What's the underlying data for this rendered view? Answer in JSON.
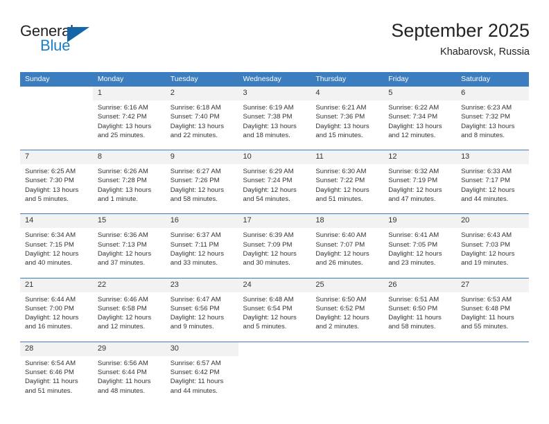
{
  "brand": {
    "word_general": "General",
    "word_blue": "Blue",
    "triangle_color": "#1466a8",
    "blue_color": "#1b7fc4"
  },
  "header": {
    "title": "September 2025",
    "subtitle": "Khabarovsk, Russia"
  },
  "theme": {
    "header_blue": "#3c7dc0",
    "daynum_bg": "#f2f2f2",
    "separator": "#3c7dc0",
    "text": "#333333"
  },
  "weekday_headers": [
    "Sunday",
    "Monday",
    "Tuesday",
    "Wednesday",
    "Thursday",
    "Friday",
    "Saturday"
  ],
  "weeks": [
    {
      "days": [
        {
          "num": "",
          "sunrise": "",
          "sunset": "",
          "daylight1": "",
          "daylight2": ""
        },
        {
          "num": "1",
          "sunrise": "Sunrise: 6:16 AM",
          "sunset": "Sunset: 7:42 PM",
          "daylight1": "Daylight: 13 hours",
          "daylight2": "and 25 minutes."
        },
        {
          "num": "2",
          "sunrise": "Sunrise: 6:18 AM",
          "sunset": "Sunset: 7:40 PM",
          "daylight1": "Daylight: 13 hours",
          "daylight2": "and 22 minutes."
        },
        {
          "num": "3",
          "sunrise": "Sunrise: 6:19 AM",
          "sunset": "Sunset: 7:38 PM",
          "daylight1": "Daylight: 13 hours",
          "daylight2": "and 18 minutes."
        },
        {
          "num": "4",
          "sunrise": "Sunrise: 6:21 AM",
          "sunset": "Sunset: 7:36 PM",
          "daylight1": "Daylight: 13 hours",
          "daylight2": "and 15 minutes."
        },
        {
          "num": "5",
          "sunrise": "Sunrise: 6:22 AM",
          "sunset": "Sunset: 7:34 PM",
          "daylight1": "Daylight: 13 hours",
          "daylight2": "and 12 minutes."
        },
        {
          "num": "6",
          "sunrise": "Sunrise: 6:23 AM",
          "sunset": "Sunset: 7:32 PM",
          "daylight1": "Daylight: 13 hours",
          "daylight2": "and 8 minutes."
        }
      ]
    },
    {
      "days": [
        {
          "num": "7",
          "sunrise": "Sunrise: 6:25 AM",
          "sunset": "Sunset: 7:30 PM",
          "daylight1": "Daylight: 13 hours",
          "daylight2": "and 5 minutes."
        },
        {
          "num": "8",
          "sunrise": "Sunrise: 6:26 AM",
          "sunset": "Sunset: 7:28 PM",
          "daylight1": "Daylight: 13 hours",
          "daylight2": "and 1 minute."
        },
        {
          "num": "9",
          "sunrise": "Sunrise: 6:27 AM",
          "sunset": "Sunset: 7:26 PM",
          "daylight1": "Daylight: 12 hours",
          "daylight2": "and 58 minutes."
        },
        {
          "num": "10",
          "sunrise": "Sunrise: 6:29 AM",
          "sunset": "Sunset: 7:24 PM",
          "daylight1": "Daylight: 12 hours",
          "daylight2": "and 54 minutes."
        },
        {
          "num": "11",
          "sunrise": "Sunrise: 6:30 AM",
          "sunset": "Sunset: 7:22 PM",
          "daylight1": "Daylight: 12 hours",
          "daylight2": "and 51 minutes."
        },
        {
          "num": "12",
          "sunrise": "Sunrise: 6:32 AM",
          "sunset": "Sunset: 7:19 PM",
          "daylight1": "Daylight: 12 hours",
          "daylight2": "and 47 minutes."
        },
        {
          "num": "13",
          "sunrise": "Sunrise: 6:33 AM",
          "sunset": "Sunset: 7:17 PM",
          "daylight1": "Daylight: 12 hours",
          "daylight2": "and 44 minutes."
        }
      ]
    },
    {
      "days": [
        {
          "num": "14",
          "sunrise": "Sunrise: 6:34 AM",
          "sunset": "Sunset: 7:15 PM",
          "daylight1": "Daylight: 12 hours",
          "daylight2": "and 40 minutes."
        },
        {
          "num": "15",
          "sunrise": "Sunrise: 6:36 AM",
          "sunset": "Sunset: 7:13 PM",
          "daylight1": "Daylight: 12 hours",
          "daylight2": "and 37 minutes."
        },
        {
          "num": "16",
          "sunrise": "Sunrise: 6:37 AM",
          "sunset": "Sunset: 7:11 PM",
          "daylight1": "Daylight: 12 hours",
          "daylight2": "and 33 minutes."
        },
        {
          "num": "17",
          "sunrise": "Sunrise: 6:39 AM",
          "sunset": "Sunset: 7:09 PM",
          "daylight1": "Daylight: 12 hours",
          "daylight2": "and 30 minutes."
        },
        {
          "num": "18",
          "sunrise": "Sunrise: 6:40 AM",
          "sunset": "Sunset: 7:07 PM",
          "daylight1": "Daylight: 12 hours",
          "daylight2": "and 26 minutes."
        },
        {
          "num": "19",
          "sunrise": "Sunrise: 6:41 AM",
          "sunset": "Sunset: 7:05 PM",
          "daylight1": "Daylight: 12 hours",
          "daylight2": "and 23 minutes."
        },
        {
          "num": "20",
          "sunrise": "Sunrise: 6:43 AM",
          "sunset": "Sunset: 7:03 PM",
          "daylight1": "Daylight: 12 hours",
          "daylight2": "and 19 minutes."
        }
      ]
    },
    {
      "days": [
        {
          "num": "21",
          "sunrise": "Sunrise: 6:44 AM",
          "sunset": "Sunset: 7:00 PM",
          "daylight1": "Daylight: 12 hours",
          "daylight2": "and 16 minutes."
        },
        {
          "num": "22",
          "sunrise": "Sunrise: 6:46 AM",
          "sunset": "Sunset: 6:58 PM",
          "daylight1": "Daylight: 12 hours",
          "daylight2": "and 12 minutes."
        },
        {
          "num": "23",
          "sunrise": "Sunrise: 6:47 AM",
          "sunset": "Sunset: 6:56 PM",
          "daylight1": "Daylight: 12 hours",
          "daylight2": "and 9 minutes."
        },
        {
          "num": "24",
          "sunrise": "Sunrise: 6:48 AM",
          "sunset": "Sunset: 6:54 PM",
          "daylight1": "Daylight: 12 hours",
          "daylight2": "and 5 minutes."
        },
        {
          "num": "25",
          "sunrise": "Sunrise: 6:50 AM",
          "sunset": "Sunset: 6:52 PM",
          "daylight1": "Daylight: 12 hours",
          "daylight2": "and 2 minutes."
        },
        {
          "num": "26",
          "sunrise": "Sunrise: 6:51 AM",
          "sunset": "Sunset: 6:50 PM",
          "daylight1": "Daylight: 11 hours",
          "daylight2": "and 58 minutes."
        },
        {
          "num": "27",
          "sunrise": "Sunrise: 6:53 AM",
          "sunset": "Sunset: 6:48 PM",
          "daylight1": "Daylight: 11 hours",
          "daylight2": "and 55 minutes."
        }
      ]
    },
    {
      "days": [
        {
          "num": "28",
          "sunrise": "Sunrise: 6:54 AM",
          "sunset": "Sunset: 6:46 PM",
          "daylight1": "Daylight: 11 hours",
          "daylight2": "and 51 minutes."
        },
        {
          "num": "29",
          "sunrise": "Sunrise: 6:56 AM",
          "sunset": "Sunset: 6:44 PM",
          "daylight1": "Daylight: 11 hours",
          "daylight2": "and 48 minutes."
        },
        {
          "num": "30",
          "sunrise": "Sunrise: 6:57 AM",
          "sunset": "Sunset: 6:42 PM",
          "daylight1": "Daylight: 11 hours",
          "daylight2": "and 44 minutes."
        },
        {
          "num": "",
          "sunrise": "",
          "sunset": "",
          "daylight1": "",
          "daylight2": ""
        },
        {
          "num": "",
          "sunrise": "",
          "sunset": "",
          "daylight1": "",
          "daylight2": ""
        },
        {
          "num": "",
          "sunrise": "",
          "sunset": "",
          "daylight1": "",
          "daylight2": ""
        },
        {
          "num": "",
          "sunrise": "",
          "sunset": "",
          "daylight1": "",
          "daylight2": ""
        }
      ]
    }
  ]
}
